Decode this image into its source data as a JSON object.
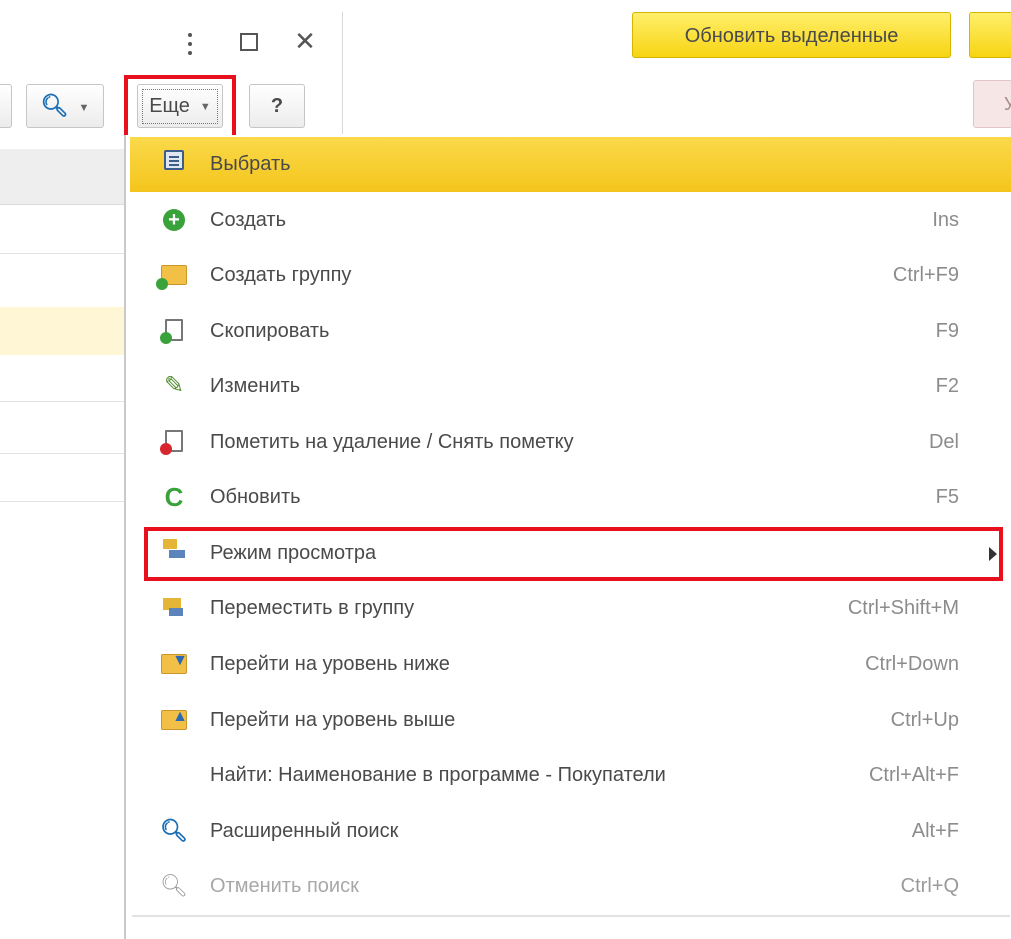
{
  "toolbar": {
    "refresh_selected_label": "Обновить выделенные",
    "more_label": "Еще",
    "help_label": "?",
    "pink_button_fragment": "У"
  },
  "icons": {
    "kebab": "vertical-dots-icon",
    "maximize": "maximize-icon",
    "close": "close-icon",
    "search": "magnifier-icon",
    "dropdown": "caret-down-icon"
  },
  "highlight_color": "#e8101c",
  "menu": {
    "items": [
      {
        "label": "Выбрать",
        "shortcut": "",
        "icon": "choose-icon",
        "active": true
      },
      {
        "label": "Создать",
        "shortcut": "Ins",
        "icon": "plus-circle-icon"
      },
      {
        "label": "Создать группу",
        "shortcut": "Ctrl+F9",
        "icon": "folder-add-icon"
      },
      {
        "label": "Скопировать",
        "shortcut": "F9",
        "icon": "copy-document-icon"
      },
      {
        "label": "Изменить",
        "shortcut": "F2",
        "icon": "pencil-icon"
      },
      {
        "label": "Пометить на удаление / Снять пометку",
        "shortcut": "Del",
        "icon": "mark-delete-icon"
      },
      {
        "label": "Обновить",
        "shortcut": "F5",
        "icon": "refresh-icon"
      },
      {
        "label": "Режим просмотра",
        "shortcut": "",
        "icon": "view-mode-icon",
        "submenu": true,
        "highlighted": true
      },
      {
        "label": "Переместить в группу",
        "shortcut": "Ctrl+Shift+M",
        "icon": "move-to-group-icon"
      },
      {
        "label": "Перейти на уровень ниже",
        "shortcut": "Ctrl+Down",
        "icon": "level-down-icon"
      },
      {
        "label": "Перейти на уровень выше",
        "shortcut": "Ctrl+Up",
        "icon": "level-up-icon"
      },
      {
        "label": "Найти: Наименование в программе - Покупатели",
        "shortcut": "Ctrl+Alt+F",
        "icon": ""
      },
      {
        "label": "Расширенный поиск",
        "shortcut": "Alt+F",
        "icon": "advanced-search-icon"
      },
      {
        "label": "Отменить поиск",
        "shortcut": "Ctrl+Q",
        "icon": "cancel-search-icon",
        "disabled": true
      }
    ]
  }
}
